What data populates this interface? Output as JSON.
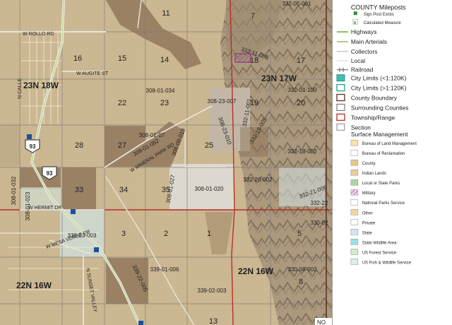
{
  "map": {
    "sections": [
      {
        "id": "s11",
        "label": "11"
      },
      {
        "id": "s7",
        "label": "7"
      },
      {
        "id": "s16",
        "label": "16"
      },
      {
        "id": "s15",
        "label": "15"
      },
      {
        "id": "s14",
        "label": "14"
      },
      {
        "id": "s18",
        "label": "18"
      },
      {
        "id": "s17",
        "label": "17"
      },
      {
        "id": "s22",
        "label": "22"
      },
      {
        "id": "s23",
        "label": "23"
      },
      {
        "id": "s19",
        "label": "19"
      },
      {
        "id": "s20",
        "label": "20"
      },
      {
        "id": "s28",
        "label": "28"
      },
      {
        "id": "s27",
        "label": "27"
      },
      {
        "id": "s25",
        "label": "25"
      },
      {
        "id": "s33",
        "label": "33"
      },
      {
        "id": "s34",
        "label": "34"
      },
      {
        "id": "s35",
        "label": "35"
      },
      {
        "id": "s3",
        "label": "3"
      },
      {
        "id": "s2",
        "label": "2"
      },
      {
        "id": "s1",
        "label": "1"
      },
      {
        "id": "s5",
        "label": "5"
      },
      {
        "id": "s8",
        "label": "8"
      },
      {
        "id": "s13",
        "label": "13"
      }
    ],
    "parcels": [
      {
        "id": "p1",
        "label": "332-05-001"
      },
      {
        "id": "p2",
        "label": "332-11-006"
      },
      {
        "id": "p3",
        "label": "308-01-034"
      },
      {
        "id": "p4",
        "label": "308-23-007"
      },
      {
        "id": "p5",
        "label": "332-11-001"
      },
      {
        "id": "p6",
        "label": "332-01-100"
      },
      {
        "id": "p7",
        "label": "308-01-082"
      },
      {
        "id": "p8",
        "label": "308-01-07"
      },
      {
        "id": "p9",
        "label": "308-09-019"
      },
      {
        "id": "p10",
        "label": "308-23-010"
      },
      {
        "id": "p11",
        "label": "332-18-002"
      },
      {
        "id": "p12",
        "label": "332-20-002"
      },
      {
        "id": "p13",
        "label": "308-01-032"
      },
      {
        "id": "p14",
        "label": "308-01-023"
      },
      {
        "id": "p15",
        "label": "308-01-027"
      },
      {
        "id": "p16",
        "label": "308-01-020"
      },
      {
        "id": "p17",
        "label": "332-21-006"
      },
      {
        "id": "p18",
        "label": "339-23-003"
      },
      {
        "id": "p19",
        "label": "339-01-006"
      },
      {
        "id": "p20",
        "label": "339-02-003"
      },
      {
        "id": "p21",
        "label": "330-06-002"
      },
      {
        "id": "p22",
        "label": "330-02"
      },
      {
        "id": "p23",
        "label": "332-22"
      },
      {
        "id": "p24",
        "label": "339-22-005"
      },
      {
        "id": "p25",
        "label": "332-19-005"
      }
    ],
    "townships": [
      {
        "id": "t1",
        "label": "23N 18W"
      },
      {
        "id": "t2",
        "label": "23N 17W"
      },
      {
        "id": "t3",
        "label": "22N 16W"
      },
      {
        "id": "t4",
        "label": "22N 16W"
      }
    ],
    "roads": [
      {
        "id": "r1",
        "label": "W ROLLO RD"
      },
      {
        "id": "r2",
        "label": "W AUGITE ST"
      },
      {
        "id": "r3",
        "label": "N CALLE"
      },
      {
        "id": "r4",
        "label": "W MINERAL PARK RD"
      },
      {
        "id": "r5",
        "label": "W HERMIT DR"
      },
      {
        "id": "r6",
        "label": "W MESA VERDE DR"
      },
      {
        "id": "r7",
        "label": "N SUNSET VALLEY"
      }
    ],
    "route_shields": [
      {
        "id": "h1",
        "label": "93"
      },
      {
        "id": "h2",
        "label": "93"
      }
    ],
    "corner_text": "NO"
  },
  "legend": {
    "mileposts_title": "COUNTY Mileposts",
    "sign_post_label": "Sign Post Exists",
    "calculated_label": "Calculated Measure",
    "lines": [
      {
        "label": "Highways",
        "color": "#8fbf5a",
        "style": "solid"
      },
      {
        "label": "Main Arterials",
        "color": "#8fbf5a",
        "style": "solid"
      },
      {
        "label": "Collectors",
        "color": "#c9c9c9",
        "style": "solid"
      },
      {
        "label": "Local",
        "color": "#d6d6d6",
        "style": "solid"
      },
      {
        "label": "Railroad",
        "color": "#555555",
        "style": "rail"
      }
    ],
    "boxes": [
      {
        "label": "City Limits (<1:120K)",
        "fill": "#3fbfb0",
        "stroke": "#2b8f84"
      },
      {
        "label": "City Limits (>1:120K)",
        "fill": "#ffffff",
        "stroke": "#2aa89a"
      },
      {
        "label": "County Boundary",
        "fill": "#ffffff",
        "stroke": "#6a3a2a"
      },
      {
        "label": "Surrounding Counties",
        "fill": "#ffffff",
        "stroke": "#777777"
      },
      {
        "label": "Township/Range",
        "fill": "#ffffff",
        "stroke": "#c0392b"
      },
      {
        "label": "Section",
        "fill": "#ffffff",
        "stroke": "#888888"
      }
    ],
    "surface_title": "Surface Management",
    "surface_items": [
      {
        "label": "Bureau of Land Management",
        "fill": "#f6e4a6",
        "hatch": false
      },
      {
        "label": "Bureau of Reclamation",
        "fill": "#ffffff",
        "hatch": false
      },
      {
        "label": "County",
        "fill": "#e6c98a",
        "hatch": false
      },
      {
        "label": "Indian Lands",
        "fill": "#f2c99a",
        "hatch": false
      },
      {
        "label": "Local or State Parks",
        "fill": "#a8d8a0",
        "hatch": false
      },
      {
        "label": "Military",
        "fill": "#e8b8d8",
        "hatch": true
      },
      {
        "label": "National Parks Service",
        "fill": "#ffffff",
        "hatch": false
      },
      {
        "label": "Other",
        "fill": "#f5d6a0",
        "hatch": false
      },
      {
        "label": "Private",
        "fill": "#ffffff",
        "hatch": false
      },
      {
        "label": "State",
        "fill": "#cfe8f6",
        "hatch": false
      },
      {
        "label": "State Wildlife Area",
        "fill": "#9fe0e8",
        "hatch": false
      },
      {
        "label": "US Forest Service",
        "fill": "#cdeccd",
        "hatch": false
      },
      {
        "label": "US Fish & Wildlife Service",
        "fill": "#d8f0e8",
        "hatch": false
      }
    ]
  }
}
